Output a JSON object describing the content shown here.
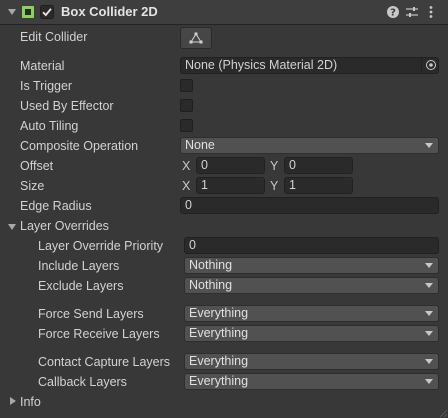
{
  "header": {
    "title": "Box Collider 2D",
    "component_enabled": true
  },
  "fields": {
    "edit_collider_label": "Edit Collider",
    "material_label": "Material",
    "material_value": "None (Physics Material 2D)",
    "is_trigger_label": "Is Trigger",
    "is_trigger": false,
    "used_by_effector_label": "Used By Effector",
    "used_by_effector": false,
    "auto_tiling_label": "Auto Tiling",
    "auto_tiling": false,
    "composite_label": "Composite Operation",
    "composite_value": "None",
    "offset_label": "Offset",
    "offset_x_label": "X",
    "offset_x": "0",
    "offset_y_label": "Y",
    "offset_y": "0",
    "size_label": "Size",
    "size_x_label": "X",
    "size_x": "1",
    "size_y_label": "Y",
    "size_y": "1",
    "edge_radius_label": "Edge Radius",
    "edge_radius": "0"
  },
  "layer_overrides": {
    "label": "Layer Overrides",
    "priority_label": "Layer Override Priority",
    "priority_value": "0",
    "include_label": "Include Layers",
    "include_value": "Nothing",
    "exclude_label": "Exclude Layers",
    "exclude_value": "Nothing",
    "force_send_label": "Force Send Layers",
    "force_send_value": "Everything",
    "force_receive_label": "Force Receive Layers",
    "force_receive_value": "Everything",
    "contact_capture_label": "Contact Capture Layers",
    "contact_capture_value": "Everything",
    "callback_label": "Callback Layers",
    "callback_value": "Everything"
  },
  "info": {
    "label": "Info"
  },
  "icons": {
    "foldout": "chevron-down-icon",
    "component": "box-collider-icon",
    "enabled_checkbox": "checkmark-icon",
    "help": "help-icon",
    "presets": "sliders-icon",
    "more": "kebab-menu-icon",
    "edit": "edit-collider-icon",
    "object_picker": "target-icon",
    "dropdown": "dropdown-arrow-icon"
  },
  "colors": {
    "background": "#383838",
    "header": "#3e3e3e",
    "field": "#2a2a2a",
    "dropdown": "#515151",
    "collider_icon": "#8ad35a"
  }
}
